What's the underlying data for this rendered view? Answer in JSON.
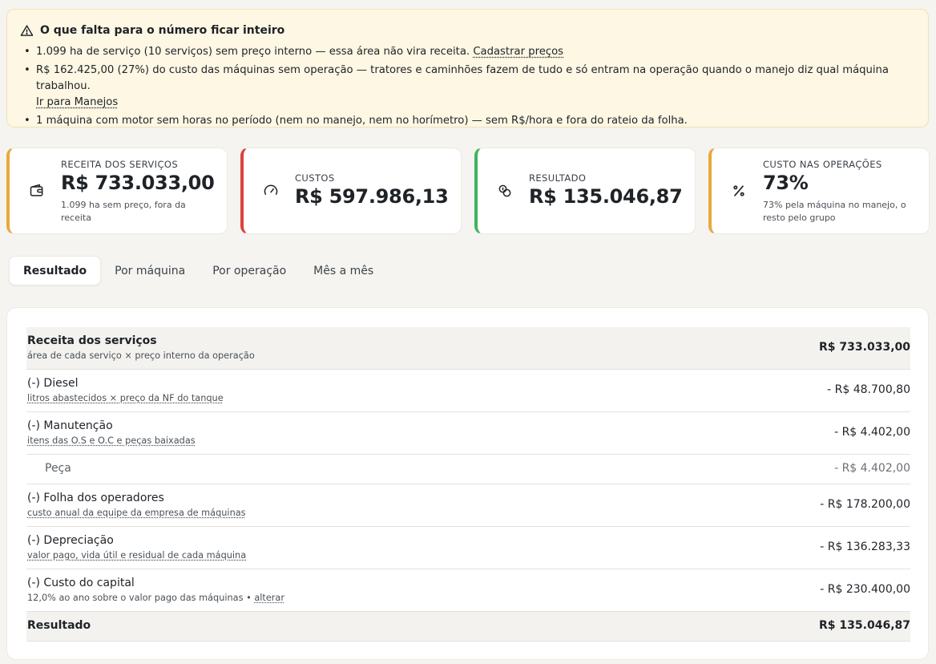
{
  "banner": {
    "title": "O que falta para o número ficar inteiro",
    "items": [
      {
        "text": "1.099 ha de serviço (10 serviços) sem preço interno — essa área não vira receita. ",
        "link": "Cadastrar preços"
      },
      {
        "text": "R$ 162.425,00 (27%) do custo das máquinas sem operação — tratores e caminhões fazem de tudo e só entram na operação quando o manejo diz qual máquina trabalhou.",
        "link": "Ir para Manejos"
      },
      {
        "text": "1 máquina com motor sem horas no período (nem no manejo, nem no horímetro) — sem R$/hora e fora do rateio da folha."
      }
    ]
  },
  "kpis": [
    {
      "label": "Receita dos serviços",
      "value": "R$ 733.033,00",
      "sub": "1.099 ha sem preço, fora da receita",
      "icon": "wallet-icon",
      "accent": "#e8a93c"
    },
    {
      "label": "Custos",
      "value": "R$ 597.986,13",
      "sub": "",
      "icon": "gauge-icon",
      "accent": "#d9443b"
    },
    {
      "label": "Resultado",
      "value": "R$ 135.046,87",
      "sub": "",
      "icon": "coins-icon",
      "accent": "#3fb35a"
    },
    {
      "label": "Custo nas operações",
      "value": "73%",
      "sub": "73% pela máquina no manejo, o resto pelo grupo",
      "icon": "percent-icon",
      "accent": "#e8a93c"
    }
  ],
  "tabs": [
    "Resultado",
    "Por máquina",
    "Por operação",
    "Mês a mês"
  ],
  "active_tab": "Resultado",
  "rows": [
    {
      "label": "Receita dos serviços",
      "desc": "área de cada serviço × preço interno da operação",
      "amount": "R$ 733.033,00"
    },
    {
      "label": "(-) Diesel",
      "desc": "litros abastecidos × preço da NF do tanque",
      "amount": "- R$ 48.700,80"
    },
    {
      "label": "(-) Manutenção",
      "desc": "itens das O.S e O.C e peças baixadas",
      "amount": "- R$ 4.402,00"
    },
    {
      "label": "Peça",
      "amount": "- R$ 4.402,00"
    },
    {
      "label": "(-) Folha dos operadores",
      "desc": "custo anual da equipe da empresa de máquinas",
      "amount": "- R$ 178.200,00"
    },
    {
      "label": "(-) Depreciação",
      "desc": "valor pago, vida útil e residual de cada máquina",
      "amount": "- R$ 136.283,33"
    },
    {
      "label": "(-) Custo do capital",
      "desc": "12,0% ao ano sobre o valor pago das máquinas • ",
      "desc_link": "alterar",
      "amount": "- R$ 230.400,00"
    },
    {
      "label": "Resultado",
      "amount": "R$ 135.046,87"
    }
  ]
}
